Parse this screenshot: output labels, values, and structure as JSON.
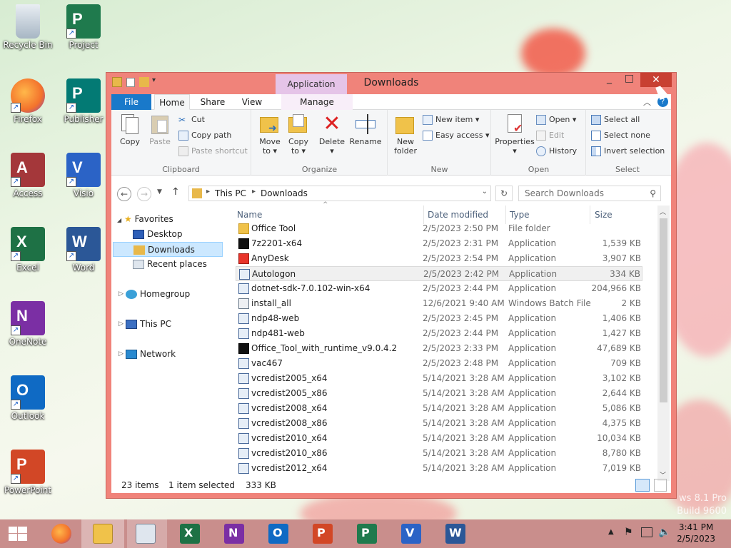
{
  "desktop": {
    "icons": [
      {
        "label": "Recycle Bin",
        "color": "#8aa0b4",
        "letter": ""
      },
      {
        "label": "Project",
        "color": "#1f7a4d",
        "letter": "P"
      },
      {
        "label": "Firefox",
        "color": "#f3722c",
        "letter": ""
      },
      {
        "label": "Publisher",
        "color": "#037a74",
        "letter": "P"
      },
      {
        "label": "Access",
        "color": "#a4373a",
        "letter": "A"
      },
      {
        "label": "Visio",
        "color": "#2b63c6",
        "letter": "V"
      },
      {
        "label": "Excel",
        "color": "#1e7145",
        "letter": "X"
      },
      {
        "label": "Word",
        "color": "#2b5797",
        "letter": "W"
      },
      {
        "label": "OneNote",
        "color": "#7b2fa4",
        "letter": "N"
      },
      {
        "label": "Outlook",
        "color": "#0f6ac4",
        "letter": "O"
      },
      {
        "label": "PowerPoint",
        "color": "#d24726",
        "letter": "P"
      }
    ],
    "watermark_line1": "ws 8.1 Pro",
    "watermark_line2": "Build 9600"
  },
  "window": {
    "title": "Downloads",
    "context_tab": "Application Tools",
    "tabs": [
      "File",
      "Home",
      "Share",
      "View",
      "Manage"
    ],
    "ribbon": {
      "clipboard": {
        "label": "Clipboard",
        "copy": "Copy",
        "paste": "Paste",
        "cut": "Cut",
        "copy_path": "Copy path",
        "paste_shortcut": "Paste shortcut"
      },
      "organize": {
        "label": "Organize",
        "move_to": "Move to",
        "copy_to": "Copy to",
        "delete": "Delete",
        "rename": "Rename"
      },
      "new": {
        "label": "New",
        "new_folder": "New folder",
        "new_item": "New item",
        "easy_access": "Easy access"
      },
      "open": {
        "label": "Open",
        "properties": "Properties",
        "open": "Open",
        "edit": "Edit",
        "history": "History"
      },
      "select": {
        "label": "Select",
        "select_all": "Select all",
        "select_none": "Select none",
        "invert": "Invert selection"
      }
    },
    "address": {
      "segments": [
        "This PC",
        "Downloads"
      ],
      "search_placeholder": "Search Downloads"
    },
    "nav": {
      "favorites": "Favorites",
      "desktop": "Desktop",
      "downloads": "Downloads",
      "recent": "Recent places",
      "homegroup": "Homegroup",
      "this_pc": "This PC",
      "network": "Network"
    },
    "columns": {
      "name": "Name",
      "date": "Date modified",
      "type": "Type",
      "size": "Size"
    },
    "files": [
      {
        "name": "Office Tool",
        "date": "2/5/2023 2:50 PM",
        "type": "File folder",
        "size": "",
        "icon": "folder"
      },
      {
        "name": "7z2201-x64",
        "date": "2/5/2023 2:31 PM",
        "type": "Application",
        "size": "1,539 KB",
        "icon": "7z"
      },
      {
        "name": "AnyDesk",
        "date": "2/5/2023 2:54 PM",
        "type": "Application",
        "size": "3,907 KB",
        "icon": "anydesk"
      },
      {
        "name": "Autologon",
        "date": "2/5/2023 2:42 PM",
        "type": "Application",
        "size": "334 KB",
        "icon": "app"
      },
      {
        "name": "dotnet-sdk-7.0.102-win-x64",
        "date": "2/5/2023 2:44 PM",
        "type": "Application",
        "size": "204,966 KB",
        "icon": "app"
      },
      {
        "name": "install_all",
        "date": "12/6/2021 9:40 AM",
        "type": "Windows Batch File",
        "size": "2 KB",
        "icon": "bat"
      },
      {
        "name": "ndp48-web",
        "date": "2/5/2023 2:45 PM",
        "type": "Application",
        "size": "1,406 KB",
        "icon": "app"
      },
      {
        "name": "ndp481-web",
        "date": "2/5/2023 2:44 PM",
        "type": "Application",
        "size": "1,427 KB",
        "icon": "app"
      },
      {
        "name": "Office_Tool_with_runtime_v9.0.4.2",
        "date": "2/5/2023 2:33 PM",
        "type": "Application",
        "size": "47,689 KB",
        "icon": "7z"
      },
      {
        "name": "vac467",
        "date": "2/5/2023 2:48 PM",
        "type": "Application",
        "size": "709 KB",
        "icon": "app"
      },
      {
        "name": "vcredist2005_x64",
        "date": "5/14/2021 3:28 AM",
        "type": "Application",
        "size": "3,102 KB",
        "icon": "app"
      },
      {
        "name": "vcredist2005_x86",
        "date": "5/14/2021 3:28 AM",
        "type": "Application",
        "size": "2,644 KB",
        "icon": "app"
      },
      {
        "name": "vcredist2008_x64",
        "date": "5/14/2021 3:28 AM",
        "type": "Application",
        "size": "5,086 KB",
        "icon": "app"
      },
      {
        "name": "vcredist2008_x86",
        "date": "5/14/2021 3:28 AM",
        "type": "Application",
        "size": "4,375 KB",
        "icon": "app"
      },
      {
        "name": "vcredist2010_x64",
        "date": "5/14/2021 3:28 AM",
        "type": "Application",
        "size": "10,034 KB",
        "icon": "app"
      },
      {
        "name": "vcredist2010_x86",
        "date": "5/14/2021 3:28 AM",
        "type": "Application",
        "size": "8,780 KB",
        "icon": "app"
      },
      {
        "name": "vcredist2012_x64",
        "date": "5/14/2021 3:28 AM",
        "type": "Application",
        "size": "7,019 KB",
        "icon": "app"
      }
    ],
    "status": {
      "count": "23 items",
      "selected": "1 item selected",
      "sel_size": "333 KB"
    }
  },
  "taskbar": {
    "time": "3:41 PM",
    "date": "2/5/2023"
  }
}
